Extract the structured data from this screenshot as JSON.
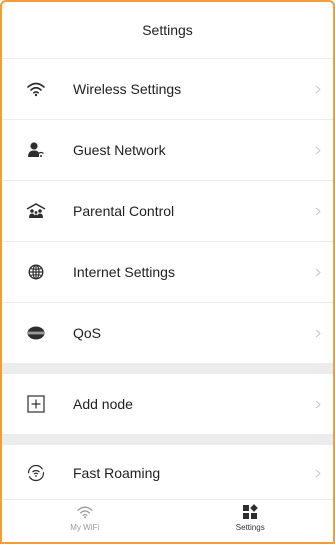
{
  "header": {
    "title": "Settings"
  },
  "menu_group1": [
    {
      "label": "Wireless Settings",
      "icon": "wifi-icon"
    },
    {
      "label": "Guest Network",
      "icon": "guest-user-icon"
    },
    {
      "label": "Parental Control",
      "icon": "parental-control-icon"
    },
    {
      "label": "Internet Settings",
      "icon": "globe-icon"
    },
    {
      "label": "QoS",
      "icon": "qos-icon"
    }
  ],
  "menu_group2": [
    {
      "label": "Add node",
      "icon": "add-box-icon"
    }
  ],
  "menu_group3": [
    {
      "label": "Fast Roaming",
      "icon": "fast-roaming-icon"
    }
  ],
  "tabbar": {
    "tabs": [
      {
        "label": "My WiFi",
        "icon": "wifi-icon",
        "active": false
      },
      {
        "label": "Settings",
        "icon": "settings-grid-icon",
        "active": true
      }
    ]
  },
  "colors": {
    "frame_border": "#f39c3a",
    "divider": "#ececec",
    "icon": "#2d2d2d",
    "tab_inactive": "#9a9a9a"
  }
}
